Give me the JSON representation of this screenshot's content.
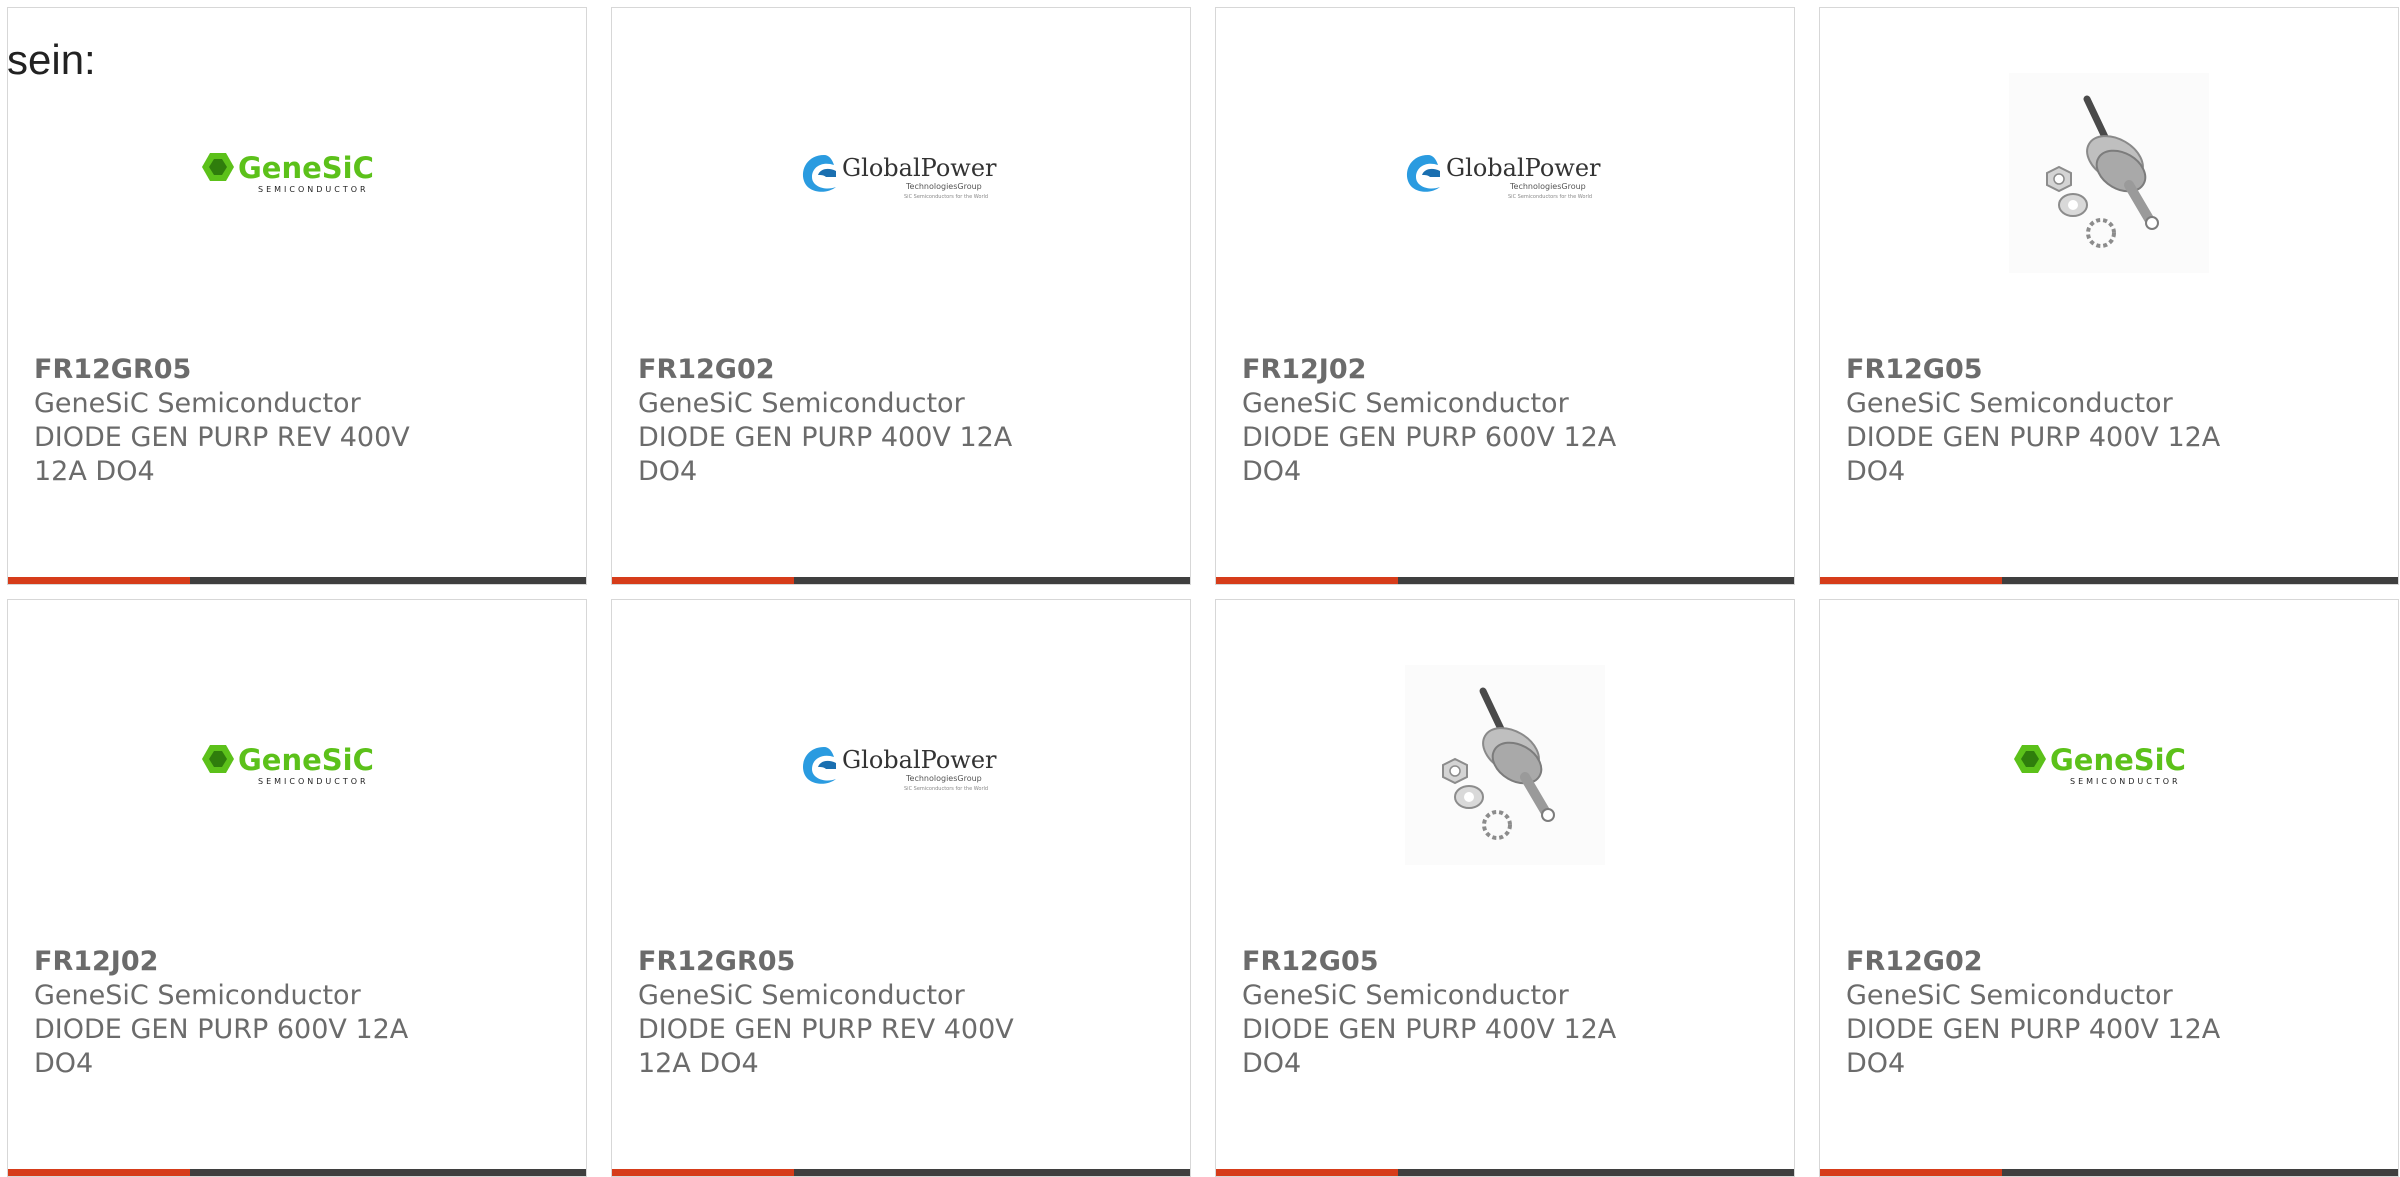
{
  "page": {
    "intro_text": "sein:"
  },
  "logos": {
    "genesic": {
      "main": "GeneSiC",
      "sub": "SEMICONDUCTOR",
      "accent_color": "#5cc11a",
      "text_color": "#1f1f1f"
    },
    "globalpower": {
      "main": "GlobalPower",
      "sub": "TechnologiesGroup",
      "tagline": "SiC Semiconductors for the World",
      "accent_color": "#2a9be0"
    }
  },
  "colors": {
    "text": "#6b6b6b",
    "bar": "#3f3f3f",
    "bar_accent": "#d63c1a",
    "border": "#d7d7d7"
  },
  "products": [
    {
      "part": "FR12GR05",
      "maker": "GeneSiC Semiconductor",
      "desc": "DIODE GEN PURP REV 400V 12A DO4",
      "image": "genesic-logo"
    },
    {
      "part": "FR12G02",
      "maker": "GeneSiC Semiconductor",
      "desc": "DIODE GEN PURP 400V 12A DO4",
      "image": "globalpower-logo"
    },
    {
      "part": "FR12J02",
      "maker": "GeneSiC Semiconductor",
      "desc": "DIODE GEN PURP 600V 12A DO4",
      "image": "globalpower-logo"
    },
    {
      "part": "FR12G05",
      "maker": "GeneSiC Semiconductor",
      "desc": "DIODE GEN PURP 400V 12A DO4",
      "image": "stud-diode-photo"
    },
    {
      "part": "FR12J02",
      "maker": "GeneSiC Semiconductor",
      "desc": "DIODE GEN PURP 600V 12A DO4",
      "image": "genesic-logo"
    },
    {
      "part": "FR12GR05",
      "maker": "GeneSiC Semiconductor",
      "desc": "DIODE GEN PURP REV 400V 12A DO4",
      "image": "globalpower-logo"
    },
    {
      "part": "FR12G05",
      "maker": "GeneSiC Semiconductor",
      "desc": "DIODE GEN PURP 400V 12A DO4",
      "image": "stud-diode-photo"
    },
    {
      "part": "FR12G02",
      "maker": "GeneSiC Semiconductor",
      "desc": "DIODE GEN PURP 400V 12A DO4",
      "image": "genesic-logo"
    }
  ]
}
